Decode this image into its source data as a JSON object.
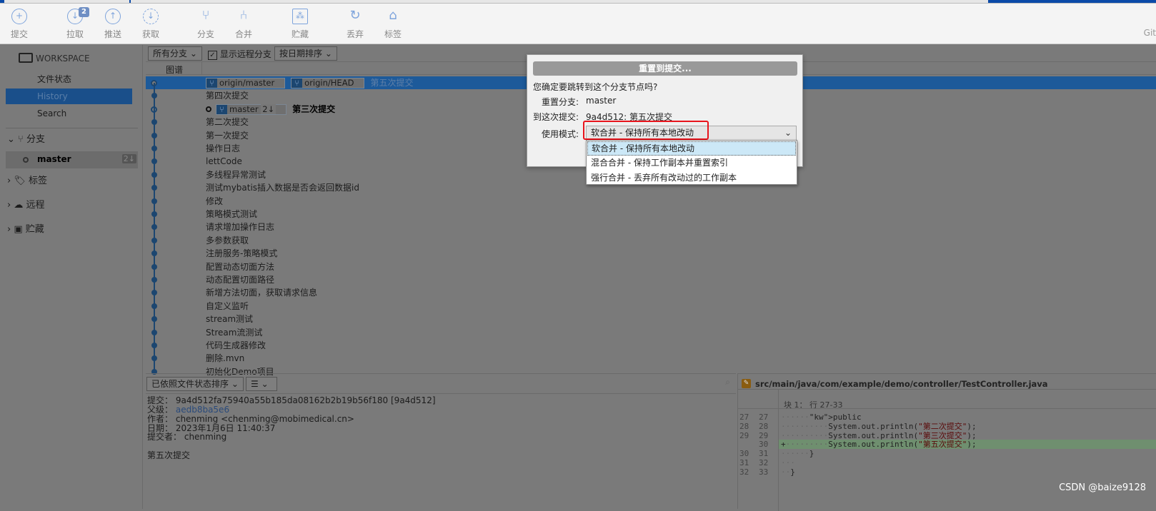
{
  "toolbar": {
    "items": [
      {
        "label": "提交",
        "icon": "plus-circle-icon"
      },
      {
        "label": "拉取",
        "icon": "pull-icon",
        "badge": "2"
      },
      {
        "label": "推送",
        "icon": "push-icon"
      },
      {
        "label": "获取",
        "icon": "fetch-icon"
      },
      {
        "label": "分支",
        "icon": "branch-icon"
      },
      {
        "label": "合并",
        "icon": "merge-icon"
      },
      {
        "label": "贮藏",
        "icon": "stash-icon"
      },
      {
        "label": "丢弃",
        "icon": "discard-icon"
      },
      {
        "label": "标签",
        "icon": "tag-icon"
      }
    ],
    "right_label": "Git"
  },
  "sidebar": {
    "workspace": "WORKSPACE",
    "items": [
      "文件状态",
      "History",
      "Search"
    ],
    "branches": "分支",
    "branch": "master",
    "branch_badge": "2↓",
    "tags": "标签",
    "remotes": "远程",
    "stashes": "贮藏"
  },
  "filters": {
    "branches": "所有分支",
    "show_remote": "显示远程分支",
    "show_remote_checked": true,
    "sort": "按日期排序"
  },
  "columns": {
    "graph": "图谱"
  },
  "commits": [
    {
      "tags": [
        "origin/master",
        "origin/HEAD"
      ],
      "msg": "第五次提交",
      "selected": true
    },
    {
      "msg": "第四次提交"
    },
    {
      "tags": [
        "master"
      ],
      "tag_badge": "2↓",
      "msg": "第三次提交",
      "bold": true
    },
    {
      "msg": "第二次提交"
    },
    {
      "msg": "第一次提交"
    },
    {
      "msg": "操作日志"
    },
    {
      "msg": "lettCode"
    },
    {
      "msg": "多线程异常测试"
    },
    {
      "msg": "测试mybatis插入数据是否会返回数据id"
    },
    {
      "msg": "修改"
    },
    {
      "msg": "策略模式测试"
    },
    {
      "msg": "请求增加操作日志"
    },
    {
      "msg": "多参数获取"
    },
    {
      "msg": "注册服务-策略模式"
    },
    {
      "msg": "配置动态切面方法"
    },
    {
      "msg": "动态配置切面路径"
    },
    {
      "msg": "新增方法切面，获取请求信息"
    },
    {
      "msg": "自定义监听"
    },
    {
      "msg": "stream测试"
    },
    {
      "msg": "Stream流测试"
    },
    {
      "msg": "代码生成器修改"
    },
    {
      "msg": "删除.mvn"
    },
    {
      "msg": "初始化Demo项目"
    }
  ],
  "details": {
    "sort": "已依照文件状态排序",
    "view": "☰",
    "commit_label": "提交：",
    "commit": "9a4d512fa75940a55b185da08162b2b19b56f180 [9a4d512]",
    "parent_label": "父级：",
    "parent": "aedb8ba5e6",
    "author_label": "作者：",
    "author": "chenming <chenming@mobimedical.cn>",
    "date_label": "日期：",
    "date": "2023年1月6日 11:40:37",
    "committer_label": "提交者：",
    "committer": "chenming",
    "message": "第五次提交"
  },
  "diff": {
    "file": "src/main/java/com/example/demo/controller/TestController.java",
    "hunk": "块 1： 行 27-33",
    "lines": [
      {
        "old": "27",
        "new": "27",
        "text": "······public·void·commitTest2()·{"
      },
      {
        "old": "28",
        "new": "28",
        "text": "··········System.out.println(\"第二次提交\");"
      },
      {
        "old": "29",
        "new": "29",
        "text": "··········System.out.println(\"第三次提交\");"
      },
      {
        "old": "",
        "new": "30",
        "text": "+·········System.out.println(\"第五次提交\");",
        "added": true
      },
      {
        "old": "30",
        "new": "31",
        "text": "······}"
      },
      {
        "old": "31",
        "new": "32",
        "text": "···"
      },
      {
        "old": "32",
        "new": "33",
        "text": "··}"
      }
    ]
  },
  "dialog": {
    "title": "重置到提交...",
    "question": "您确定要跳转到这个分支节点吗?",
    "branch_label": "重置分支:",
    "branch": "master",
    "commit_label": "到这次提交:",
    "commit": "9a4d512: 第五次提交",
    "mode_label": "使用模式:",
    "mode": "软合并 - 保持所有本地改动",
    "options": [
      "软合并 - 保持所有本地改动",
      "混合合并 - 保持工作副本并重置索引",
      "强行合并 - 丢弃所有改动过的工作副本"
    ]
  },
  "watermark": "CSDN @baize9128",
  "colors": {
    "accent": "#1d5a9a",
    "highlight": "#e8141c",
    "added": "#6f8f6f"
  }
}
